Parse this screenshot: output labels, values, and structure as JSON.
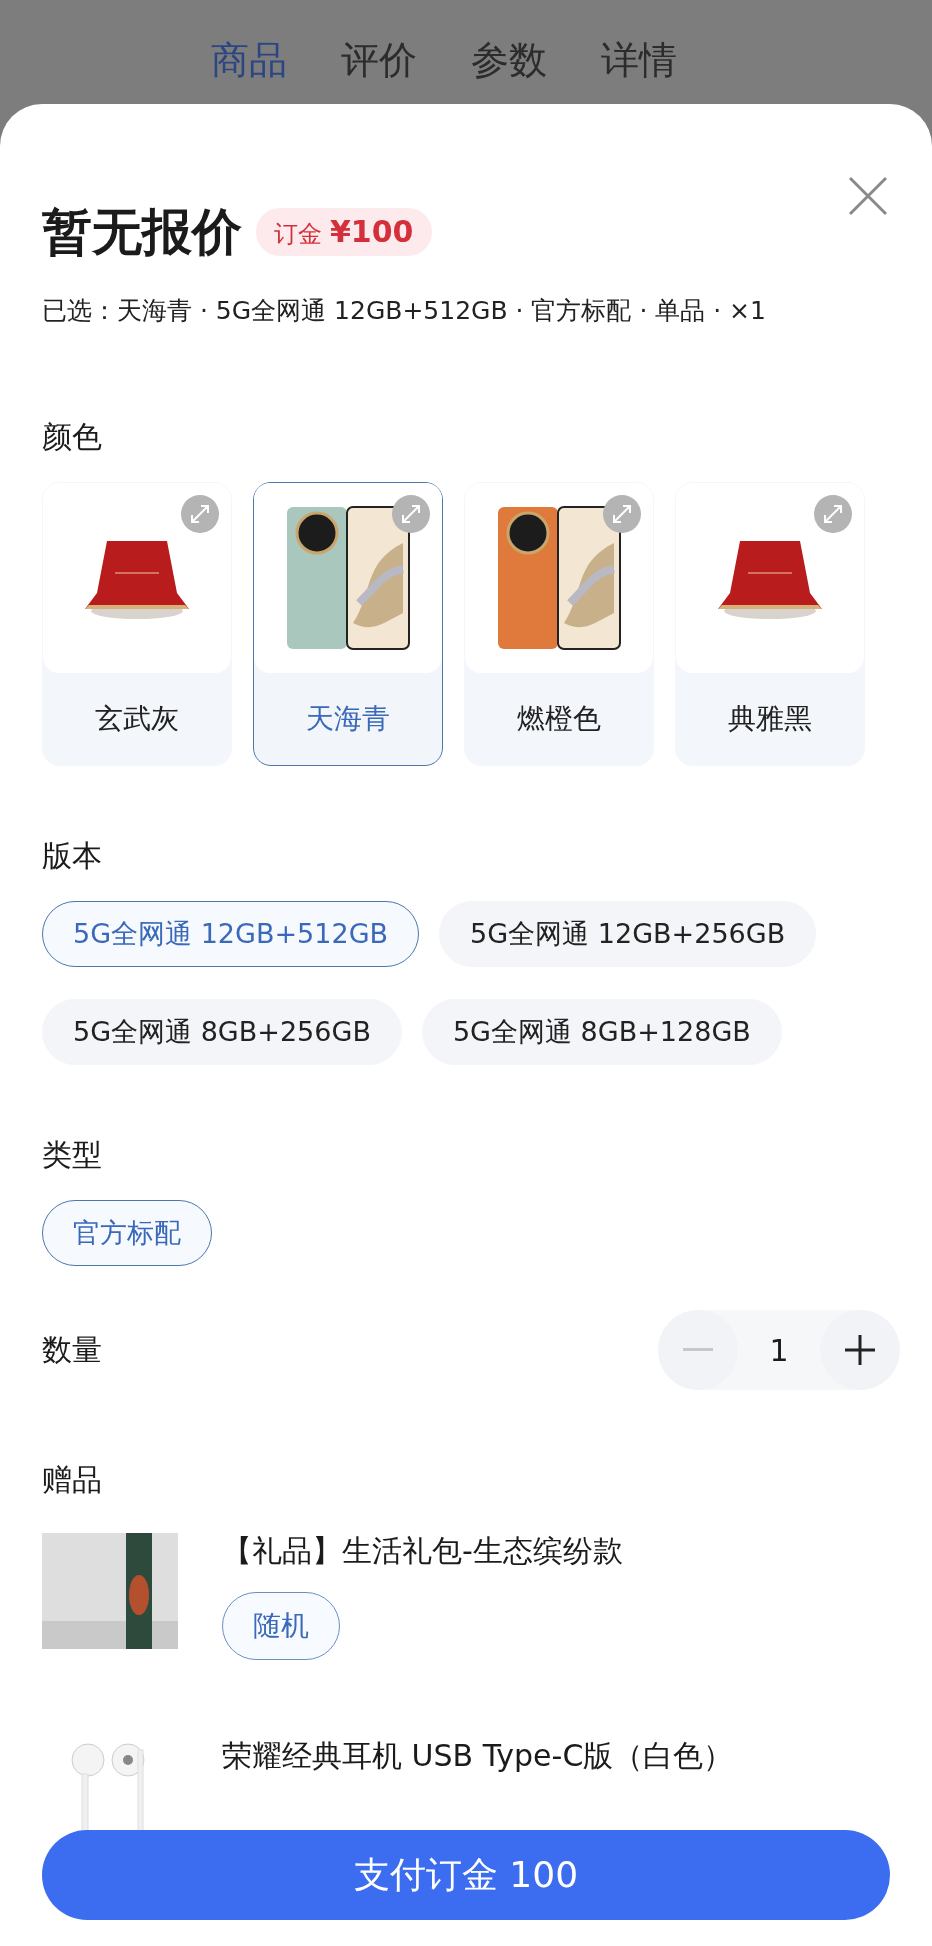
{
  "tabs": [
    {
      "label": "商品",
      "selected": true
    },
    {
      "label": "评价",
      "selected": false
    },
    {
      "label": "参数",
      "selected": false
    },
    {
      "label": "详情",
      "selected": false
    }
  ],
  "sheet": {
    "title": "暂无报价",
    "deposit_label": "订金",
    "deposit_price": "¥100",
    "summary": "已选：天海青 · 5G全网通 12GB+512GB · 官方标配 · 单品 · ×1"
  },
  "color_section": {
    "heading": "颜色",
    "options": [
      {
        "label": "玄武灰",
        "kind": "veiled",
        "selected": false
      },
      {
        "label": "天海青",
        "kind": "phone",
        "color": "#a9c7bc",
        "selected": true
      },
      {
        "label": "燃橙色",
        "kind": "phone",
        "color": "#e07a3c",
        "selected": false
      },
      {
        "label": "典雅黑",
        "kind": "veiled",
        "selected": false
      }
    ]
  },
  "version_section": {
    "heading": "版本",
    "options": [
      {
        "label": "5G全网通 12GB+512GB",
        "selected": true
      },
      {
        "label": "5G全网通 12GB+256GB",
        "selected": false
      },
      {
        "label": "5G全网通 8GB+256GB",
        "selected": false
      },
      {
        "label": "5G全网通 8GB+128GB",
        "selected": false
      }
    ]
  },
  "type_section": {
    "heading": "类型",
    "options": [
      {
        "label": "官方标配",
        "selected": true
      }
    ]
  },
  "quantity": {
    "heading": "数量",
    "value": "1",
    "decrease_disabled": true
  },
  "gifts": {
    "heading": "赠品",
    "items": [
      {
        "kind": "gift_box",
        "name": "【礼品】生活礼包-生态缤纷款",
        "tag": "随机"
      },
      {
        "kind": "earphones",
        "name": "荣耀经典耳机 USB Type-C版（白色）"
      }
    ]
  },
  "pay_button": "支付订金 100"
}
